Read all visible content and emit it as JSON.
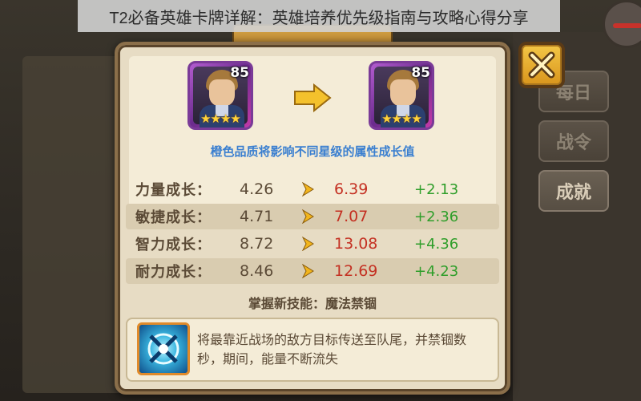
{
  "header": {
    "prefix": "",
    "title": "T2必备英雄卡牌详解：英雄培养优先级指南与攻略心得分享"
  },
  "side_tabs": [
    {
      "label": "每日",
      "active": false
    },
    {
      "label": "战令",
      "active": false
    },
    {
      "label": "成就",
      "active": true
    }
  ],
  "upgrade": {
    "from_level": "85",
    "to_level": "85",
    "from_stars": "★★★★",
    "to_stars": "★★★★",
    "note": "橙色品质将影响不同星级的属性成长值"
  },
  "stats": [
    {
      "label": "力量成长：",
      "old": "4.26",
      "new": "6.39",
      "diff": "+2.13"
    },
    {
      "label": "敏捷成长：",
      "old": "4.71",
      "new": "7.07",
      "diff": "+2.36"
    },
    {
      "label": "智力成长：",
      "old": "8.72",
      "new": "13.08",
      "diff": "+4.36"
    },
    {
      "label": "耐力成长：",
      "old": "8.46",
      "new": "12.69",
      "diff": "+4.23"
    }
  ],
  "skill": {
    "title": "掌握新技能：魔法禁锢",
    "description": "将最靠近战场的敌方目标传送至队尾，并禁锢数秒，期间，能量不断流失"
  },
  "colors": {
    "dialog_bg": "#e7dcc4",
    "note_blue": "#3a7fd0",
    "new_red": "#c43022",
    "diff_green": "#2f9e2a",
    "close_gold": "#f3c746"
  },
  "icons": {
    "close": "close-x-icon",
    "upgrade_arrow": "arrow-right-icon",
    "stat_arrow": "small-arrow-right-icon",
    "skill": "magic-imprison-skill-icon"
  }
}
